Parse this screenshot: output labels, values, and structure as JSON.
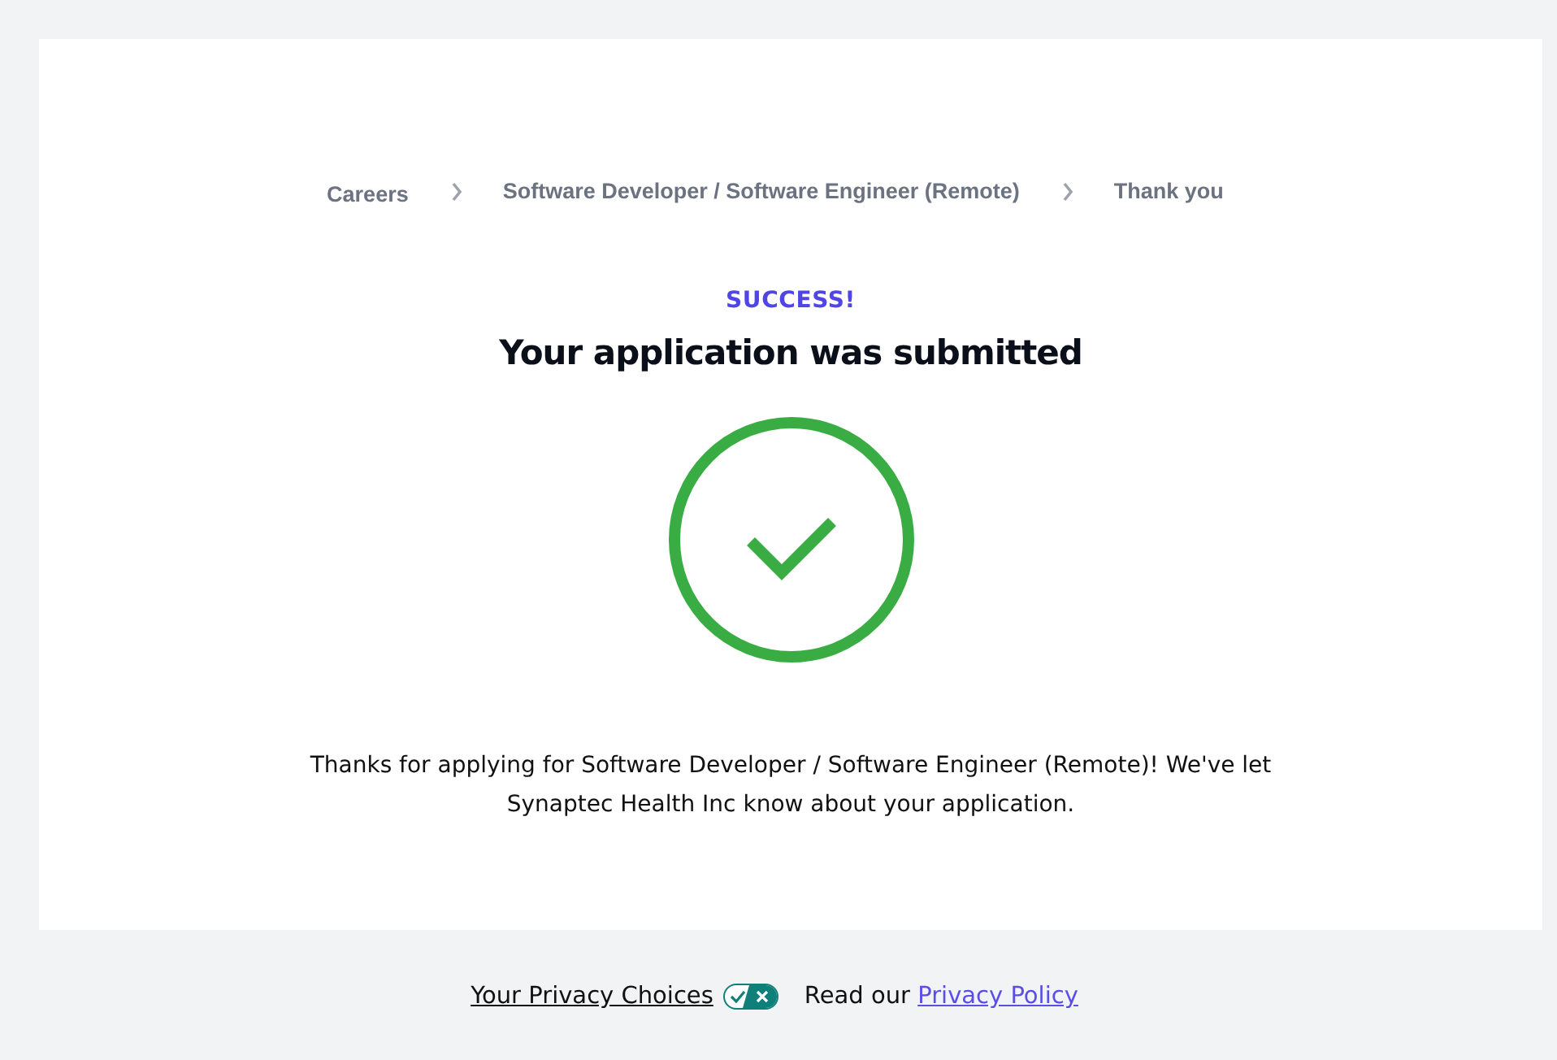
{
  "breadcrumb": [
    {
      "label": "Careers"
    },
    {
      "label": "Software Developer / Software Engineer (Remote)"
    },
    {
      "label": "Thank you"
    }
  ],
  "eyebrow": "SUCCESS!",
  "heading": "Your application was submitted",
  "message": "Thanks for applying for Software Developer / Software Engineer (Remote)! We've let Synaptec Health Inc know about your application.",
  "footer": {
    "privacy_choices": "Your Privacy Choices",
    "policy_prefix": "Read our ",
    "policy_link": "Privacy Policy"
  }
}
